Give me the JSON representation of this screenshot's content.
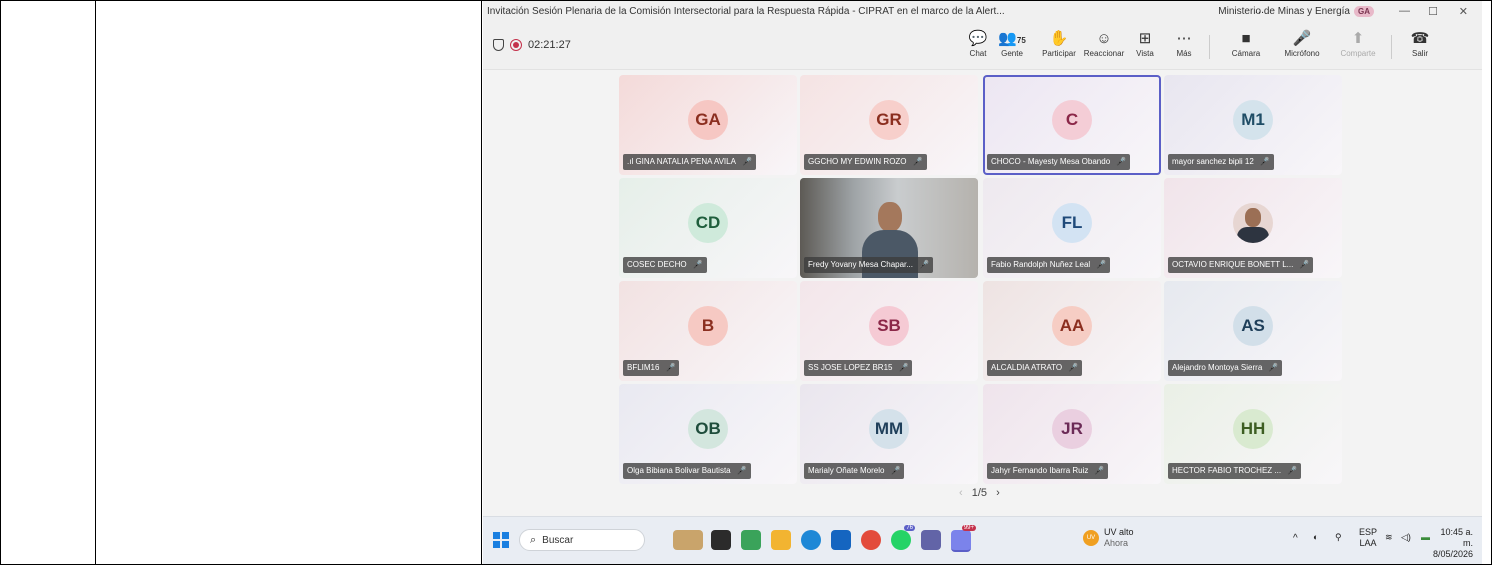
{
  "window": {
    "title": "Invitación  Sesión Plenaria de la Comisión Intersectorial para la Respuesta Rápida - CIPRAT en el marco de la  Alert...",
    "more": "...",
    "organization": "Ministerio de Minas y Energía",
    "org_badge": "GA",
    "minimize": "—",
    "maximize": "☐",
    "close": "✕"
  },
  "meeting": {
    "timer": "02:21:27",
    "people_count": "75"
  },
  "toolbar": [
    {
      "id": "chat",
      "label": "Chat",
      "glyph": "💬"
    },
    {
      "id": "people",
      "label": "Gente",
      "glyph": "👥"
    },
    {
      "id": "raise",
      "label": "Participar",
      "glyph": "✋"
    },
    {
      "id": "react",
      "label": "Reaccionar",
      "glyph": "☺"
    },
    {
      "id": "view",
      "label": "Vista",
      "glyph": "⊞"
    },
    {
      "id": "more",
      "label": "Más",
      "glyph": "⋯"
    },
    {
      "id": "camera",
      "label": "Cámara",
      "glyph": "■"
    },
    {
      "id": "mic",
      "label": "Micrófono",
      "glyph": "🎤"
    },
    {
      "id": "share",
      "label": "Comparte",
      "glyph": "⬆"
    },
    {
      "id": "leave",
      "label": "Salir",
      "glyph": "☎"
    }
  ],
  "participants": [
    {
      "initials": "GA",
      "name": ".ıl GINA NATALIA PENA AVILA",
      "bg": "#f4dad9",
      "avatar_bg": "#f6c7c3",
      "color": "#8b2e1f"
    },
    {
      "initials": "GR",
      "name": "GGCHO MY EDWIN ROZO",
      "bg": "#f5e3e3",
      "avatar_bg": "#f7cfcb",
      "color": "#8b2e1f"
    },
    {
      "initials": "C",
      "name": "CHOCO - Mayesty Mesa Obando",
      "bg": "#ece6f2",
      "avatar_bg": "#f4cdd6",
      "color": "#8b2748"
    },
    {
      "initials": "M1",
      "name": "mayor sanchez bipli 12",
      "bg": "#e8e6f0",
      "avatar_bg": "#d4e3ec",
      "color": "#1f4d66"
    },
    {
      "initials": "CD",
      "name": "COSEC DECHO",
      "bg": "#e6efe9",
      "avatar_bg": "#cfeadb",
      "color": "#1f5e3c"
    },
    {
      "initials": "",
      "name": "Fredy Yovany Mesa Chapar...",
      "bg": "#8a8f93",
      "avatar_bg": "",
      "color": ""
    },
    {
      "initials": "FL",
      "name": "Fabio Randolph Nuñez Leal",
      "bg": "#eee9ef",
      "avatar_bg": "#d3e3f3",
      "color": "#1f4a7a"
    },
    {
      "initials": "",
      "name": "OCTAVIO ENRIQUE BONETT L...",
      "bg": "#f1e4ea",
      "avatar_bg": "",
      "color": ""
    },
    {
      "initials": "B",
      "name": "BFLIM16",
      "bg": "#f2e2e2",
      "avatar_bg": "#f6c9c3",
      "color": "#8b2e1f"
    },
    {
      "initials": "SB",
      "name": "SS JOSE LOPEZ BR15",
      "bg": "#f3e6ea",
      "avatar_bg": "#f5cad4",
      "color": "#8b2748"
    },
    {
      "initials": "AA",
      "name": "ALCALDIA ATRATO",
      "bg": "#eee3e2",
      "avatar_bg": "#f6cdc4",
      "color": "#8b2e1f"
    },
    {
      "initials": "AS",
      "name": "Alejandro Montoya Sierra",
      "bg": "#e6e9ef",
      "avatar_bg": "#d2dfe9",
      "color": "#1f3f5a"
    },
    {
      "initials": "OB",
      "name": "Olga Bibiana Bolivar Bautista",
      "bg": "#e9e9f1",
      "avatar_bg": "#d3e6de",
      "color": "#1f4d3c"
    },
    {
      "initials": "MM",
      "name": "Marialy Oñate Morelo",
      "bg": "#eae6ee",
      "avatar_bg": "#d4e1ea",
      "color": "#1f3f5a"
    },
    {
      "initials": "JR",
      "name": "Jahyr Fernando Ibarra Ruiz",
      "bg": "#efe4ec",
      "avatar_bg": "#eacfe0",
      "color": "#6b2a56"
    },
    {
      "initials": "HH",
      "name": "HECTOR FABIO TROCHEZ ...",
      "bg": "#eaf0e6",
      "avatar_bg": "#d9ead0",
      "color": "#3d5e22"
    }
  ],
  "pager": {
    "text": "1/5",
    "prev": "‹",
    "next": "›"
  },
  "taskbar": {
    "search_label": "Buscar",
    "weather_title": "UV alto",
    "weather_sub": "Ahora",
    "weather_badge": "UV",
    "lang_top": "ESP",
    "lang_bottom": "LAA",
    "time": "10:45 a. m.",
    "date": "8/05/2026",
    "badge_76": "76",
    "badge_99": "99+"
  }
}
